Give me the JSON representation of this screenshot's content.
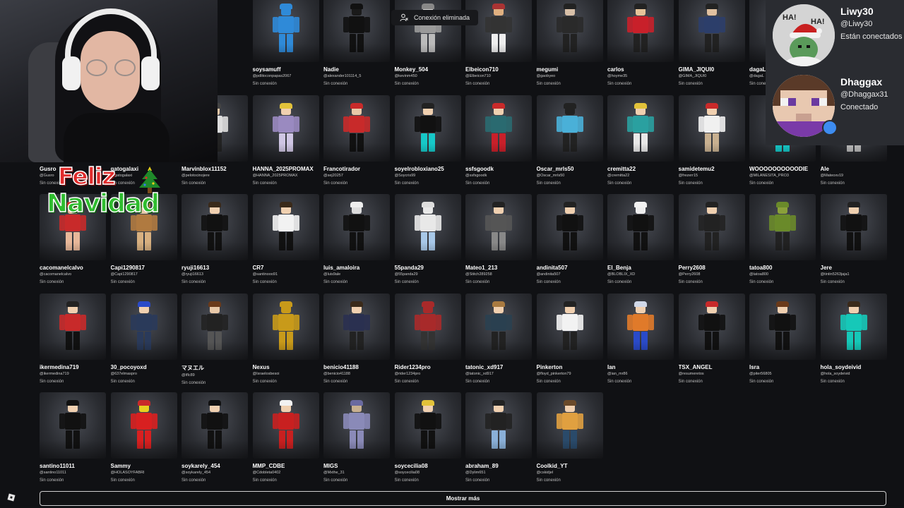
{
  "toast": {
    "text": "Conexión eliminada",
    "icon": "user-disconnected-icon"
  },
  "friends": [
    {
      "name": "",
      "handle": "",
      "status": "",
      "skin": "#f0c7a0",
      "hair": "#c22",
      "shirt": "#c22",
      "pants": "#eee"
    },
    {
      "name": "",
      "handle": "",
      "status": "",
      "skin": "#d0d0d0",
      "hair": "#555",
      "shirt": "#555",
      "pants": "#333"
    },
    {
      "name": "",
      "handle": "",
      "status": "",
      "skin": "#d0d0d0",
      "hair": "#555",
      "shirt": "#555",
      "pants": "#333"
    },
    {
      "name": "soysamuff",
      "handle": "@pdlitoconpapas2067",
      "status": "Sin conexión",
      "skin": "#2f8ad8",
      "hair": "#2f8ad8",
      "shirt": "#2f8ad8",
      "pants": "#2f8ad8"
    },
    {
      "name": "Nadie",
      "handle": "@alexander101114_5",
      "status": "Sin conexión",
      "skin": "#1a1a1a",
      "hair": "#111",
      "shirt": "#111",
      "pants": "#111"
    },
    {
      "name": "Monkey_504",
      "handle": "@kevinm450",
      "status": "Sin conexión",
      "skin": "#d8d8d8",
      "hair": "#888",
      "shirt": "#9a9a9a",
      "pants": "#bbb"
    },
    {
      "name": "Elbeicon710",
      "handle": "@Elbeicon710",
      "status": "Sin conexión",
      "skin": "#e0b080",
      "hair": "#a33",
      "shirt": "#333",
      "pants": "#eee"
    },
    {
      "name": "megumi",
      "handle": "@gaobyeo",
      "status": "Sin conexión",
      "skin": "#d8c0a8",
      "hair": "#222",
      "shirt": "#2a2a2a",
      "pants": "#222"
    },
    {
      "name": "carlos",
      "handle": "@hoyme35",
      "status": "Sin conexión",
      "skin": "#e6c49a",
      "hair": "#222",
      "shirt": "#c8202a",
      "pants": "#222"
    },
    {
      "name": "GIMA_JIQUI0",
      "handle": "@GIMA_JIQUI0",
      "status": "Sin conexión",
      "skin": "#e0c0a0",
      "hair": "#222",
      "shirt": "#2c3e6a",
      "pants": "#222"
    },
    {
      "name": "dagaL",
      "handle": "@dagaL",
      "status": "Sin conexión",
      "skin": "#d0d0d0",
      "hair": "#444",
      "shirt": "#444",
      "pants": "#333"
    },
    {
      "name": "",
      "handle": "",
      "status": "",
      "skin": "#d0d0d0",
      "hair": "#444",
      "shirt": "#444",
      "pants": "#333"
    },
    {
      "name": "Gusro",
      "handle": "@Gusro",
      "status": "Sin conexión",
      "skin": "#d0d0d0",
      "hair": "#444",
      "shirt": "#444",
      "pants": "#333"
    },
    {
      "name": "gatogalaxi",
      "handle": "@gatogalaxi",
      "status": "Sin conexión",
      "skin": "#d0d0d0",
      "hair": "#444",
      "shirt": "#444",
      "pants": "#333"
    },
    {
      "name": "Marvinblox11152",
      "handle": "@pelotocinojere",
      "status": "Sin conexión",
      "skin": "#e8c8a8",
      "hair": "#444",
      "shirt": "#ddd",
      "pants": "#222"
    },
    {
      "name": "HANNA_2025PROMAX",
      "handle": "@HANNA_2025PROMAX",
      "status": "Sin conexión",
      "skin": "#f0d0b0",
      "hair": "#e2c23a",
      "shirt": "#9a8ac0",
      "pants": "#cfc6e4"
    },
    {
      "name": "Francotirador",
      "handle": "@sej20257",
      "status": "Sin conexión",
      "skin": "#e8c8a8",
      "hair": "#c82a2a",
      "shirt": "#c82a2a",
      "pants": "#111"
    },
    {
      "name": "soyelrobloxiano25",
      "handle": "@Soycris99",
      "status": "Sin conexión",
      "skin": "#f0d0b0",
      "hair": "#222",
      "shirt": "#111",
      "pants": "#16c8c8"
    },
    {
      "name": "ssfsgoodk",
      "handle": "@ssfsgoodk",
      "status": "Sin conexión",
      "skin": "#f0d0b0",
      "hair": "#c82a2a",
      "shirt": "#2a6a70",
      "pants": "#c8202a"
    },
    {
      "name": "Oscar_mrls50",
      "handle": "@Oscar_mrls50",
      "status": "Sin conexión",
      "skin": "#222",
      "hair": "#222",
      "shirt": "#4ab0d8",
      "pants": "#222"
    },
    {
      "name": "cremitta22",
      "handle": "@cremitta22",
      "status": "Sin conexión",
      "skin": "#f0d0b0",
      "hair": "#e2c23a",
      "shirt": "#2aa0a0",
      "pants": "#e8e8e8"
    },
    {
      "name": "samidetemu2",
      "handle": "@frezerr15",
      "status": "Sin conexión",
      "skin": "#f0d0b0",
      "hair": "#c82a2a",
      "shirt": "#f0f0f0",
      "pants": "#c8b090"
    },
    {
      "name": "WOOOOOOOOOODIE",
      "handle": "@MILANESITA_PRO3",
      "status": "Sin conexión",
      "skin": "#222",
      "hair": "#222",
      "shirt": "#222",
      "pants": "#16c8c8"
    },
    {
      "name": "Ale",
      "handle": "@Mateoxv19",
      "status": "Sin conexión",
      "skin": "#e0e0e0",
      "hair": "#999",
      "shirt": "#bbb",
      "pants": "#bbb"
    },
    {
      "name": "cacomanelcalvo",
      "handle": "@cacomanelcalvo",
      "status": "Sin conexión",
      "skin": "#e8b89a",
      "hair": "#c82a2a",
      "shirt": "#c82a2a",
      "pants": "#e8b89a"
    },
    {
      "name": "Capi1290817",
      "handle": "@Capi1290817",
      "status": "Sin conexión",
      "skin": "#e8c8a8",
      "hair": "#b07a40",
      "shirt": "#b07a40",
      "pants": "#d8b080"
    },
    {
      "name": "ryuji16613",
      "handle": "@ryuji16613",
      "status": "Sin conexión",
      "skin": "#f0d0b0",
      "hair": "#3a2a1a",
      "shirt": "#111",
      "pants": "#111"
    },
    {
      "name": "CR7",
      "handle": "@santinooo91",
      "status": "Sin conexión",
      "skin": "#f0d0b0",
      "hair": "#3a2a1a",
      "shirt": "#f2f2f2",
      "pants": "#111"
    },
    {
      "name": "luis_amaloira",
      "handle": "@luis9ale",
      "status": "Sin conexión",
      "skin": "#ddd",
      "hair": "#eee",
      "shirt": "#111",
      "pants": "#111"
    },
    {
      "name": "55panda29",
      "handle": "@55panda29",
      "status": "Sin conexión",
      "skin": "#e8e8e8",
      "hair": "#ddd",
      "shirt": "#e8e8e8",
      "pants": "#a8c8e8"
    },
    {
      "name": "Mateo1_213",
      "handle": "@Stitch289258",
      "status": "Sin conexión",
      "skin": "#f0d0b0",
      "hair": "#222",
      "shirt": "#555",
      "pants": "#888"
    },
    {
      "name": "andinita507",
      "handle": "@andinita507",
      "status": "Sin conexión",
      "skin": "#f0d0b0",
      "hair": "#222",
      "shirt": "#111",
      "pants": "#111"
    },
    {
      "name": "El_Benja",
      "handle": "@BLOBLIX_XD",
      "status": "Sin conexión",
      "skin": "#eee",
      "hair": "#f2f2f2",
      "shirt": "#111",
      "pants": "#111"
    },
    {
      "name": "Perry2608",
      "handle": "@Perry2608",
      "status": "Sin conexión",
      "skin": "#f0d0b0",
      "hair": "#222",
      "shirt": "#222",
      "pants": "#222"
    },
    {
      "name": "tatoa800",
      "handle": "@tatoa800",
      "status": "Sin conexión",
      "skin": "#8aa03a",
      "hair": "#6a8a2a",
      "shirt": "#6a8a2a",
      "pants": "#222"
    },
    {
      "name": "Jere",
      "handle": "@tintin5263jaja1",
      "status": "Sin conexión",
      "skin": "#f0d0b0",
      "hair": "#222",
      "shirt": "#111",
      "pants": "#111"
    },
    {
      "name": "ikermedina719",
      "handle": "@ikermedina719",
      "status": "Sin conexión",
      "skin": "#f0d0b0",
      "hair": "#222",
      "shirt": "#c82a2a",
      "pants": "#111"
    },
    {
      "name": "30_pocoyoxd",
      "handle": "@637elmaspro",
      "status": "Sin conexión",
      "skin": "#f0d0b0",
      "hair": "#2a4ac8",
      "shirt": "#2a3a5a",
      "pants": "#2a3a5a"
    },
    {
      "name": "マヌエル",
      "handle": "@tflc89",
      "status": "Sin conexión",
      "skin": "#e8c8a8",
      "hair": "#6a3a1a",
      "shirt": "#222",
      "pants": "#555"
    },
    {
      "name": "Nexus",
      "handle": "@Israelosbesoi",
      "status": "Sin conexión",
      "skin": "#c89a1a",
      "hair": "#c89a1a",
      "shirt": "#c89a1a",
      "pants": "#c89a1a"
    },
    {
      "name": "benicio41188",
      "handle": "@benicio41188",
      "status": "Sin conexión",
      "skin": "#f0d0b0",
      "hair": "#3a2a1a",
      "shirt": "#2a3050",
      "pants": "#222"
    },
    {
      "name": "Rider1234pro",
      "handle": "@rider1234pro",
      "status": "Sin conexión",
      "skin": "#a82a2a",
      "hair": "#a82a2a",
      "shirt": "#a82a2a",
      "pants": "#333"
    },
    {
      "name": "tatonic_xd917",
      "handle": "@tatonic_xd917",
      "status": "Sin conexión",
      "skin": "#f0d0b0",
      "hair": "#a87a40",
      "shirt": "#2a4050",
      "pants": "#222"
    },
    {
      "name": "Pinkerton",
      "handle": "@floyd_pinkerton79",
      "status": "Sin conexión",
      "skin": "#f0d0b0",
      "hair": "#222",
      "shirt": "#f2f2f2",
      "pants": "#222"
    },
    {
      "name": "Ian",
      "handle": "@ian_mr86",
      "status": "Sin conexión",
      "skin": "#f0d0b0",
      "hair": "#d0d8e8",
      "shirt": "#e07a2a",
      "pants": "#2a4ac8"
    },
    {
      "name": "TSX_ANGEL",
      "handle": "@resumeretos",
      "status": "Sin conexión",
      "skin": "#f0d0b0",
      "hair": "#c82a2a",
      "shirt": "#111",
      "pants": "#111"
    },
    {
      "name": "Isra",
      "handle": "@piter56805",
      "status": "Sin conexión",
      "skin": "#f0d0b0",
      "hair": "#6a3a1a",
      "shirt": "#111",
      "pants": "#111"
    },
    {
      "name": "hola_soydeivid",
      "handle": "@hola_soydeivid",
      "status": "Sin conexión",
      "skin": "#f0d0b0",
      "hair": "#3a2a1a",
      "shirt": "#16c8b8",
      "pants": "#16c8b8"
    },
    {
      "name": "santino11011",
      "handle": "@santino11011",
      "status": "Sin conexión",
      "skin": "#f0d0b0",
      "hair": "#111",
      "shirt": "#111",
      "pants": "#111"
    },
    {
      "name": "Sammy",
      "handle": "@HOLASOYFABRI",
      "status": "Sin conexión",
      "skin": "#e8d020",
      "hair": "#c82a2a",
      "shirt": "#d82020",
      "pants": "#d82020"
    },
    {
      "name": "soykarely_454",
      "handle": "@soykarely_454",
      "status": "Sin conexión",
      "skin": "#f0d0b0",
      "hair": "#111",
      "shirt": "#111",
      "pants": "#111"
    },
    {
      "name": "MMP_CDBE",
      "handle": "@Cdobleta0402",
      "status": "Sin conexión",
      "skin": "#f0d0b0",
      "hair": "#f2f2f2",
      "shirt": "#c82020",
      "pants": "#c82020"
    },
    {
      "name": "MIGS",
      "handle": "@Mxthe_31",
      "status": "Sin conexión",
      "skin": "#c8b090",
      "hair": "#6a6aa0",
      "shirt": "#8a8ab8",
      "pants": "#8a8ab8"
    },
    {
      "name": "soycecilia08",
      "handle": "@soycecilia08",
      "status": "Sin conexión",
      "skin": "#f0d0b0",
      "hair": "#e2c23a",
      "shirt": "#111",
      "pants": "#111"
    },
    {
      "name": "abraham_89",
      "handle": "@Dylim651",
      "status": "Sin conexión",
      "skin": "#f0d0b0",
      "hair": "#222",
      "shirt": "#222",
      "pants": "#8ab0d8"
    },
    {
      "name": "Coolkid_YT",
      "handle": "@cskidjel",
      "status": "Sin conexión",
      "skin": "#f0d0b0",
      "hair": "#6a4a2a",
      "shirt": "#e0a040",
      "pants": "#2a4a6a"
    }
  ],
  "show_more_label": "Mostrar más",
  "sticker": {
    "line1": "Feliz",
    "line2": "Navidad"
  },
  "voice_users": [
    {
      "name": "Liwy30",
      "handle": "@Liwy30",
      "status": "Están conectados",
      "icon": "santa-hat-avatar"
    },
    {
      "name": "Dhaggax",
      "handle": "@Dhaggax31",
      "status": "Conectado",
      "icon": "pixel-face-avatar"
    }
  ]
}
